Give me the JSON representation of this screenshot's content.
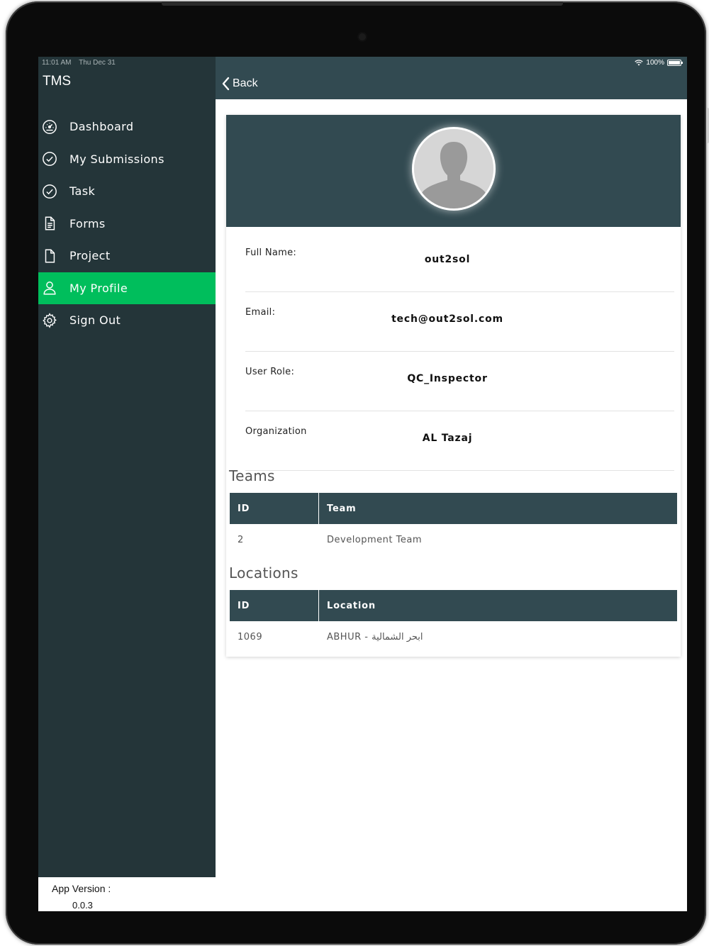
{
  "status_bar": {
    "time": "11:01 AM",
    "date": "Thu Dec 31",
    "battery": "100%"
  },
  "app": {
    "title": "TMS"
  },
  "menu": [
    {
      "label": "Dashboard",
      "icon": "dashboard-gauge-icon",
      "active": false
    },
    {
      "label": "My Submissions",
      "icon": "check-circle-icon",
      "active": false
    },
    {
      "label": "Task",
      "icon": "check-circle-icon",
      "active": false
    },
    {
      "label": "Forms",
      "icon": "document-icon",
      "active": false
    },
    {
      "label": "Project",
      "icon": "file-icon",
      "active": false
    },
    {
      "label": "My Profile",
      "icon": "user-icon",
      "active": true
    },
    {
      "label": "Sign Out",
      "icon": "gear-icon",
      "active": false
    }
  ],
  "version": {
    "label": "App Version :",
    "value": "0.0.3"
  },
  "header": {
    "back_label": "Back"
  },
  "profile": {
    "fields": [
      {
        "label": "Full Name:",
        "value": "out2sol"
      },
      {
        "label": "Email:",
        "value": "tech@out2sol.com"
      },
      {
        "label": "User Role:",
        "value": "QC_Inspector"
      },
      {
        "label": "Organization",
        "value": "AL Tazaj"
      }
    ]
  },
  "teams": {
    "title": "Teams",
    "headers": [
      "ID",
      "Team"
    ],
    "rows": [
      [
        "2",
        "Development Team"
      ]
    ]
  },
  "locations": {
    "title": "Locations",
    "headers": [
      "ID",
      "Location"
    ],
    "rows": [
      [
        "1069",
        "ABHUR - ابحر الشمالية"
      ]
    ]
  },
  "colors": {
    "sidebar_bg": "#243539",
    "header_bg": "#324a51",
    "active_item": "#00be5c"
  }
}
